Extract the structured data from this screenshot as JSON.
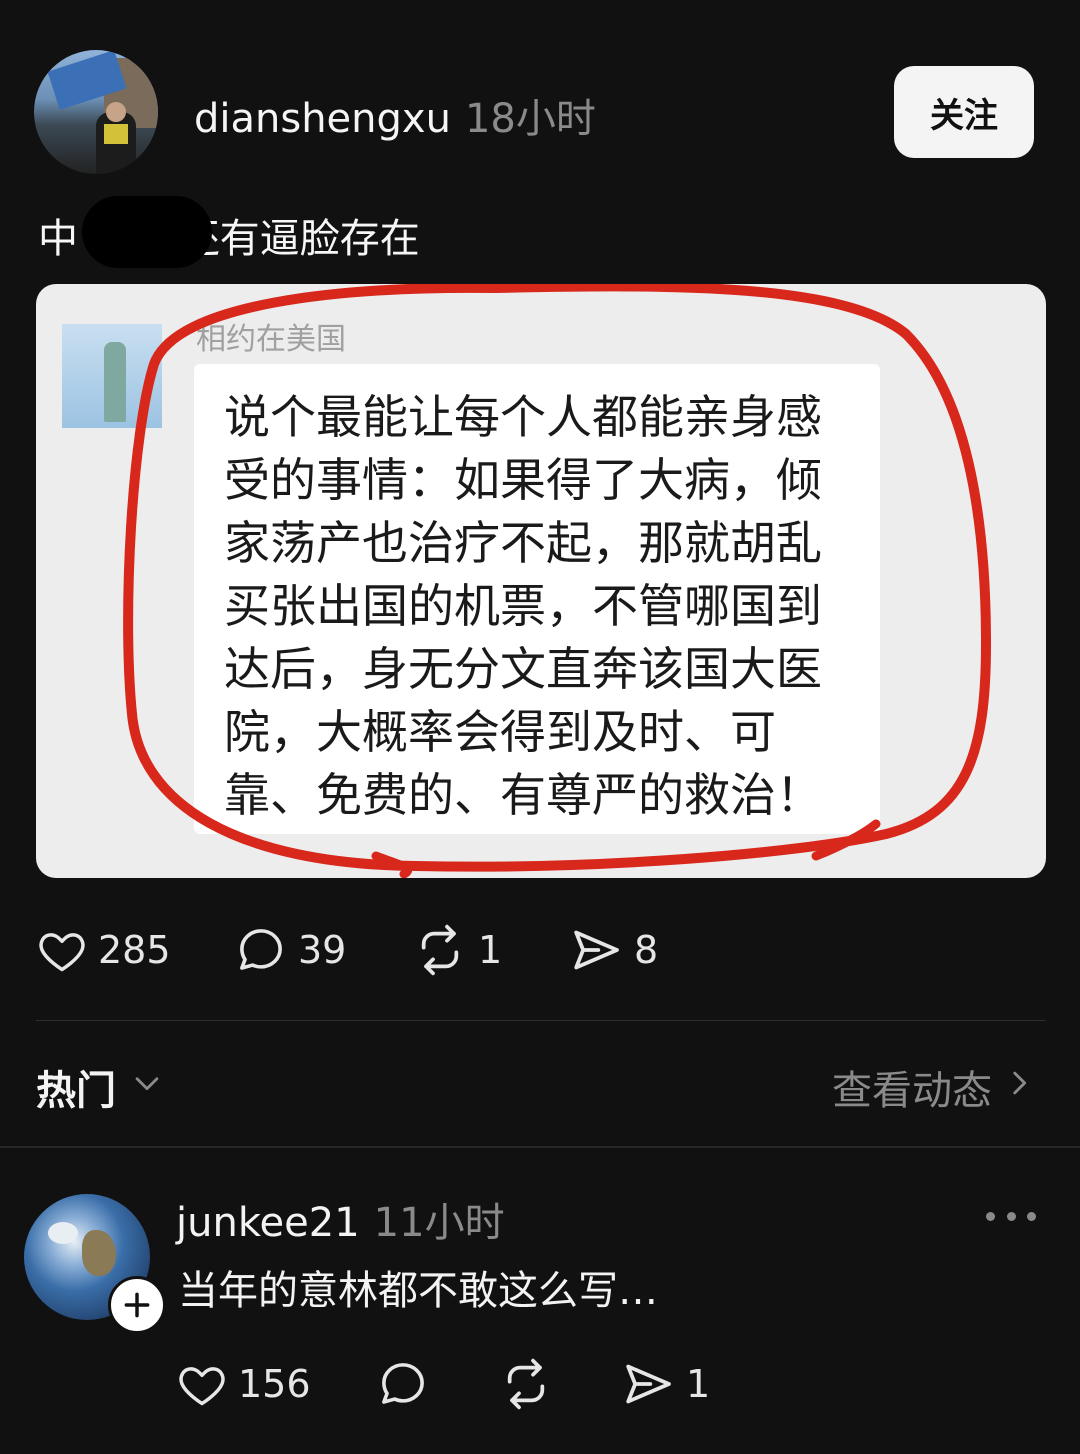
{
  "post": {
    "username": "dianshengxu",
    "time": "18小时",
    "follow_label": "关注",
    "text": "中        还有逼脸存在",
    "image": {
      "sender_name": "相约在美国",
      "message": "说个最能让每个人都能亲身感受的事情：如果得了大病，倾家荡产也治疗不起，那就胡乱买张出国的机票，不管哪国到达后，身无分文直奔该国大医院，大概率会得到及时、可靠、免费的、有尊严的救治！"
    },
    "stats": {
      "likes": "285",
      "comments": "39",
      "reposts": "1",
      "shares": "8"
    }
  },
  "section": {
    "sort_label": "热门",
    "view_activity_label": "查看动态"
  },
  "comment": {
    "username": "junkee21",
    "time": "11小时",
    "text": "当年的意林都不敢这么写…",
    "stats": {
      "likes": "156",
      "shares": "1"
    }
  },
  "colors": {
    "background": "#111111",
    "muted": "#8a8a8a",
    "annotation_red": "#d8281c"
  }
}
